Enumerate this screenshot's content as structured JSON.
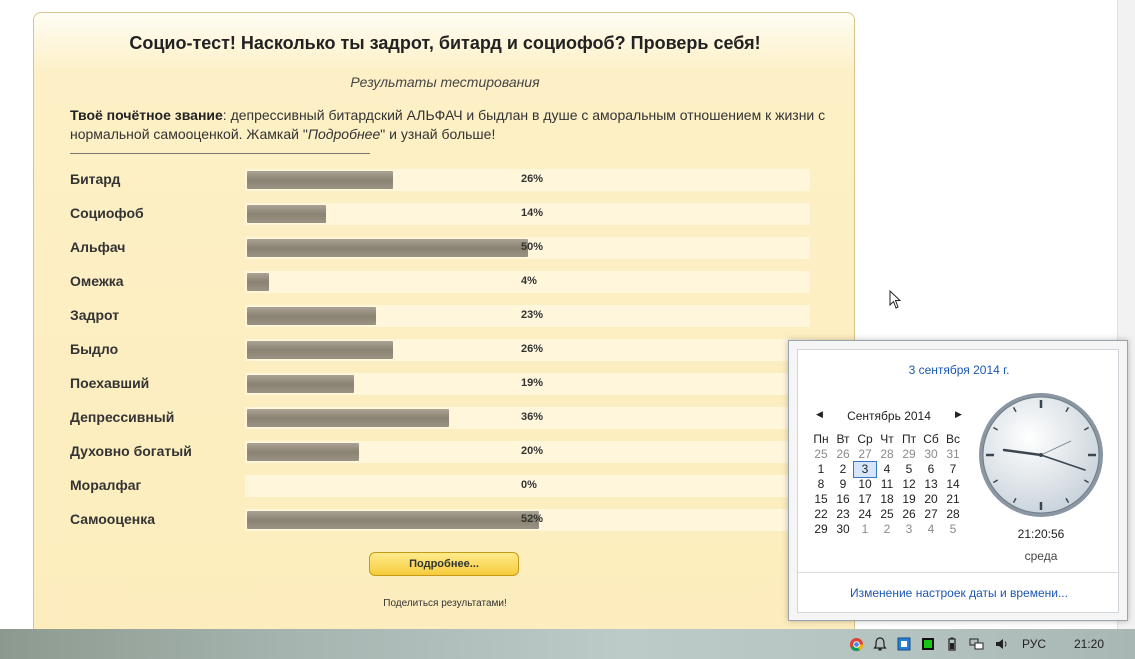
{
  "page": {
    "title": "Социо-тест! Насколько ты задрот, битард и социофоб? Проверь себя!",
    "subtitle": "Результаты тестирования",
    "rank_label": "Твоё почётное звание",
    "rank_text": ": депрессивный битардский АЛЬФАЧ и быдлан в душе с аморальным отношением к жизни с нормальной самооценкой. Жамкай \"",
    "rank_link": "Подробнее",
    "rank_tail": "\" и узнай больше!",
    "more_button": "Подробнее...",
    "share_text": "Поделиться результатами!"
  },
  "results": [
    {
      "label": "Битард",
      "percent": 26,
      "percent_text": "26%"
    },
    {
      "label": "Социофоб",
      "percent": 14,
      "percent_text": "14%"
    },
    {
      "label": "Альфач",
      "percent": 50,
      "percent_text": "50%"
    },
    {
      "label": "Омежка",
      "percent": 4,
      "percent_text": "4%"
    },
    {
      "label": "Задрот",
      "percent": 23,
      "percent_text": "23%"
    },
    {
      "label": "Быдло",
      "percent": 26,
      "percent_text": "26%"
    },
    {
      "label": "Поехавший",
      "percent": 19,
      "percent_text": "19%"
    },
    {
      "label": "Депрессивный",
      "percent": 36,
      "percent_text": "36%"
    },
    {
      "label": "Духовно богатый",
      "percent": 20,
      "percent_text": "20%"
    },
    {
      "label": "Моралфаг",
      "percent": 0,
      "percent_text": "0%"
    },
    {
      "label": "Самооценка",
      "percent": 52,
      "percent_text": "52%"
    }
  ],
  "calendar": {
    "header_date": "3 сентября 2014 г.",
    "month_label": "Сентябрь 2014",
    "weekdays": [
      "Пн",
      "Вт",
      "Ср",
      "Чт",
      "Пт",
      "Сб",
      "Вс"
    ],
    "weeks": [
      [
        "25",
        "26",
        "27",
        "28",
        "29",
        "30",
        "31"
      ],
      [
        "1",
        "2",
        "3",
        "4",
        "5",
        "6",
        "7"
      ],
      [
        "8",
        "9",
        "10",
        "11",
        "12",
        "13",
        "14"
      ],
      [
        "15",
        "16",
        "17",
        "18",
        "19",
        "20",
        "21"
      ],
      [
        "22",
        "23",
        "24",
        "25",
        "26",
        "27",
        "28"
      ],
      [
        "29",
        "30",
        "1",
        "2",
        "3",
        "4",
        "5"
      ]
    ],
    "today": "3",
    "time": "21:20:56",
    "weekday": "среда",
    "footer_link": "Изменение настроек даты и времени..."
  },
  "taskbar": {
    "language": "РУС",
    "time": "21:20",
    "tray_icons": [
      "chrome-icon",
      "notification-bell-icon",
      "network-adapter-icon",
      "green-app-icon",
      "battery-icon",
      "network-icon",
      "volume-icon"
    ]
  }
}
